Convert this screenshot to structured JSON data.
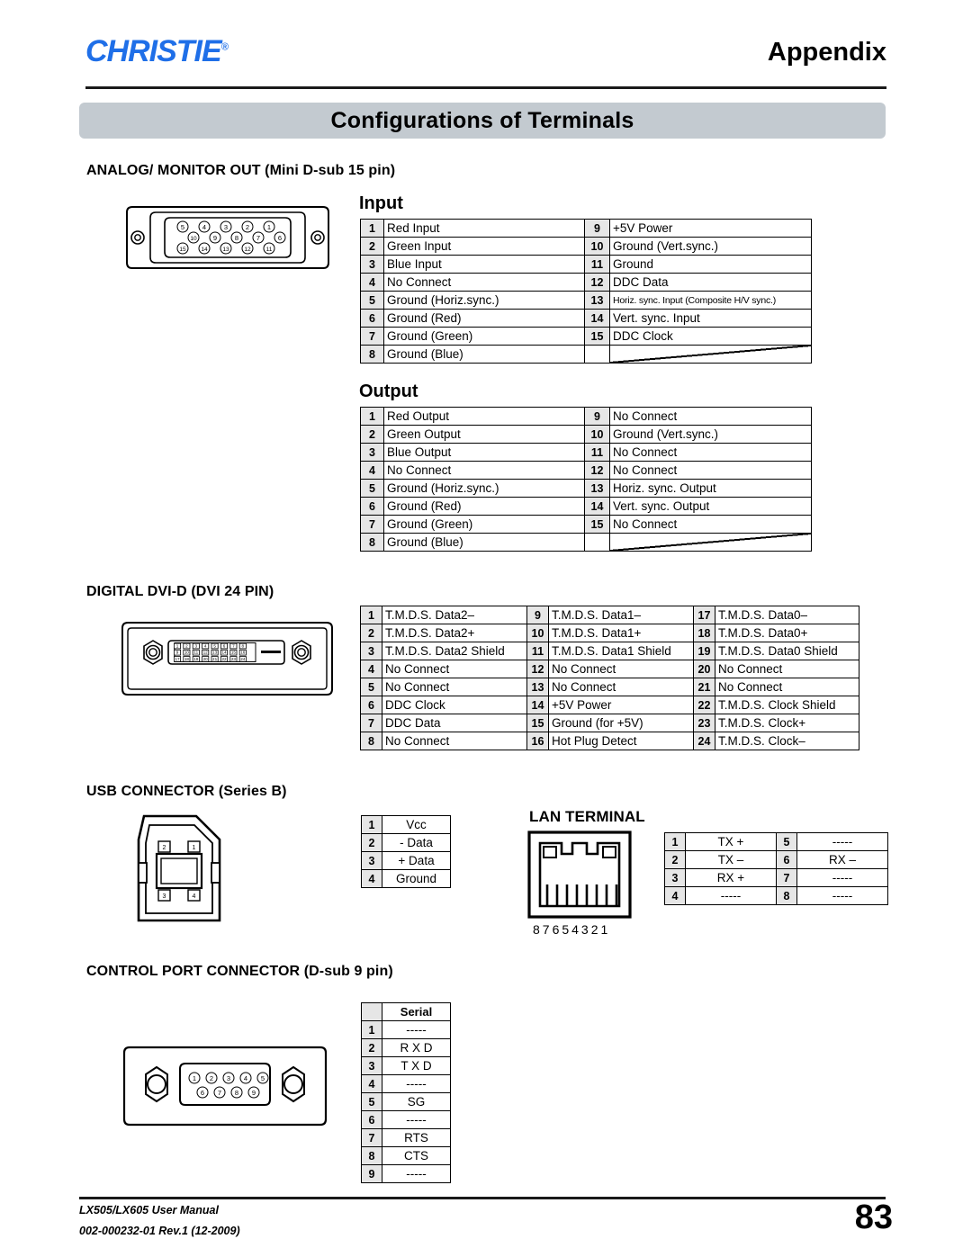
{
  "header": {
    "logo_text": "CHRISTIE",
    "logo_mark": "®",
    "logo_color": "#1f6fe8",
    "section_title": "Appendix"
  },
  "title_banner": {
    "text": "Configurations of Terminals",
    "bg_color": "#c3cad0"
  },
  "sections": {
    "analog": {
      "heading": "ANALOG/ MONITOR OUT (Mini D-sub 15 pin)",
      "connector_pins": [
        [
          "5",
          "4",
          "3",
          "2",
          "1"
        ],
        [
          "10",
          "9",
          "8",
          "7",
          "6"
        ],
        [
          "15",
          "14",
          "13",
          "12",
          "11"
        ]
      ],
      "input": {
        "label": "Input",
        "left": [
          {
            "pin": "1",
            "signal": "Red Input"
          },
          {
            "pin": "2",
            "signal": "Green Input"
          },
          {
            "pin": "3",
            "signal": "Blue Input"
          },
          {
            "pin": "4",
            "signal": "No Connect"
          },
          {
            "pin": "5",
            "signal": "Ground (Horiz.sync.)"
          },
          {
            "pin": "6",
            "signal": "Ground (Red)"
          },
          {
            "pin": "7",
            "signal": "Ground (Green)"
          },
          {
            "pin": "8",
            "signal": "Ground (Blue)"
          }
        ],
        "right": [
          {
            "pin": "9",
            "signal": "+5V Power"
          },
          {
            "pin": "10",
            "signal": "Ground (Vert.sync.)"
          },
          {
            "pin": "11",
            "signal": "Ground"
          },
          {
            "pin": "12",
            "signal": "DDC Data"
          },
          {
            "pin": "13",
            "signal": "Horiz. sync. Input (Composite H/V sync.)",
            "small": true
          },
          {
            "pin": "14",
            "signal": "Vert. sync. Input"
          },
          {
            "pin": "15",
            "signal": "DDC Clock"
          },
          {
            "pin": "",
            "signal": ""
          }
        ]
      },
      "output": {
        "label": "Output",
        "left": [
          {
            "pin": "1",
            "signal": "Red Output"
          },
          {
            "pin": "2",
            "signal": "Green Output"
          },
          {
            "pin": "3",
            "signal": "Blue Output"
          },
          {
            "pin": "4",
            "signal": "No Connect"
          },
          {
            "pin": "5",
            "signal": "Ground (Horiz.sync.)"
          },
          {
            "pin": "6",
            "signal": "Ground (Red)"
          },
          {
            "pin": "7",
            "signal": "Ground (Green)"
          },
          {
            "pin": "8",
            "signal": "Ground (Blue)"
          }
        ],
        "right": [
          {
            "pin": "9",
            "signal": "No Connect"
          },
          {
            "pin": "10",
            "signal": "Ground (Vert.sync.)"
          },
          {
            "pin": "11",
            "signal": "No Connect"
          },
          {
            "pin": "12",
            "signal": "No Connect"
          },
          {
            "pin": "13",
            "signal": "Horiz. sync. Output"
          },
          {
            "pin": "14",
            "signal": "Vert. sync. Output"
          },
          {
            "pin": "15",
            "signal": "No Connect"
          },
          {
            "pin": "",
            "signal": ""
          }
        ]
      }
    },
    "dvi": {
      "heading": "DIGITAL DVI-D (DVI 24 PIN)",
      "connector_pins": [
        [
          "1",
          "2",
          "3",
          "4",
          "5",
          "6",
          "7",
          "8"
        ],
        [
          "9",
          "10",
          "11",
          "12",
          "13",
          "14",
          "15",
          "16"
        ],
        [
          "17",
          "18",
          "19",
          "20",
          "21",
          "22",
          "23",
          "24"
        ]
      ],
      "col1": [
        {
          "pin": "1",
          "signal": "T.M.D.S. Data2–"
        },
        {
          "pin": "2",
          "signal": "T.M.D.S. Data2+"
        },
        {
          "pin": "3",
          "signal": "T.M.D.S. Data2 Shield"
        },
        {
          "pin": "4",
          "signal": "No Connect"
        },
        {
          "pin": "5",
          "signal": "No Connect"
        },
        {
          "pin": "6",
          "signal": "DDC Clock"
        },
        {
          "pin": "7",
          "signal": "DDC Data"
        },
        {
          "pin": "8",
          "signal": "No Connect"
        }
      ],
      "col2": [
        {
          "pin": "9",
          "signal": "T.M.D.S. Data1–"
        },
        {
          "pin": "10",
          "signal": "T.M.D.S. Data1+"
        },
        {
          "pin": "11",
          "signal": "T.M.D.S. Data1 Shield"
        },
        {
          "pin": "12",
          "signal": "No Connect"
        },
        {
          "pin": "13",
          "signal": "No Connect"
        },
        {
          "pin": "14",
          "signal": "+5V Power"
        },
        {
          "pin": "15",
          "signal": "Ground (for +5V)"
        },
        {
          "pin": "16",
          "signal": "Hot Plug Detect"
        }
      ],
      "col3": [
        {
          "pin": "17",
          "signal": "T.M.D.S. Data0–"
        },
        {
          "pin": "18",
          "signal": "T.M.D.S. Data0+"
        },
        {
          "pin": "19",
          "signal": "T.M.D.S. Data0 Shield"
        },
        {
          "pin": "20",
          "signal": "No Connect"
        },
        {
          "pin": "21",
          "signal": "No Connect"
        },
        {
          "pin": "22",
          "signal": "T.M.D.S. Clock Shield"
        },
        {
          "pin": "23",
          "signal": "T.M.D.S. Clock+"
        },
        {
          "pin": "24",
          "signal": "T.M.D.S. Clock–"
        }
      ]
    },
    "usb": {
      "heading": "USB CONNECTOR (Series B)",
      "connector_pins_top": [
        "2",
        "1"
      ],
      "connector_pins_bottom": [
        "3",
        "4"
      ],
      "rows": [
        {
          "pin": "1",
          "signal": "Vcc"
        },
        {
          "pin": "2",
          "signal": "- Data"
        },
        {
          "pin": "3",
          "signal": "+ Data"
        },
        {
          "pin": "4",
          "signal": "Ground"
        }
      ]
    },
    "lan": {
      "heading": "LAN TERMINAL",
      "connector_pin_labels": "87654321",
      "left": [
        {
          "pin": "1",
          "signal": "TX +"
        },
        {
          "pin": "2",
          "signal": "TX –"
        },
        {
          "pin": "3",
          "signal": "RX +"
        },
        {
          "pin": "4",
          "signal": "-----"
        }
      ],
      "right": [
        {
          "pin": "5",
          "signal": "-----"
        },
        {
          "pin": "6",
          "signal": "RX –"
        },
        {
          "pin": "7",
          "signal": "-----"
        },
        {
          "pin": "8",
          "signal": "-----"
        }
      ]
    },
    "control": {
      "heading": "CONTROL PORT CONNECTOR (D-sub 9 pin)",
      "connector_pins_top": [
        "1",
        "2",
        "3",
        "4",
        "5"
      ],
      "connector_pins_bottom": [
        "6",
        "7",
        "8",
        "9"
      ],
      "column_header": "Serial",
      "rows": [
        {
          "pin": "1",
          "signal": "-----"
        },
        {
          "pin": "2",
          "signal": "R X D"
        },
        {
          "pin": "3",
          "signal": "T X D"
        },
        {
          "pin": "4",
          "signal": "-----"
        },
        {
          "pin": "5",
          "signal": "SG"
        },
        {
          "pin": "6",
          "signal": "-----"
        },
        {
          "pin": "7",
          "signal": "RTS"
        },
        {
          "pin": "8",
          "signal": "CTS"
        },
        {
          "pin": "9",
          "signal": "-----"
        }
      ]
    }
  },
  "footer": {
    "manual": "LX505/LX605 User Manual",
    "doc_id": "002-000232-01 Rev.1 (12-2009)",
    "page_number": "83"
  }
}
